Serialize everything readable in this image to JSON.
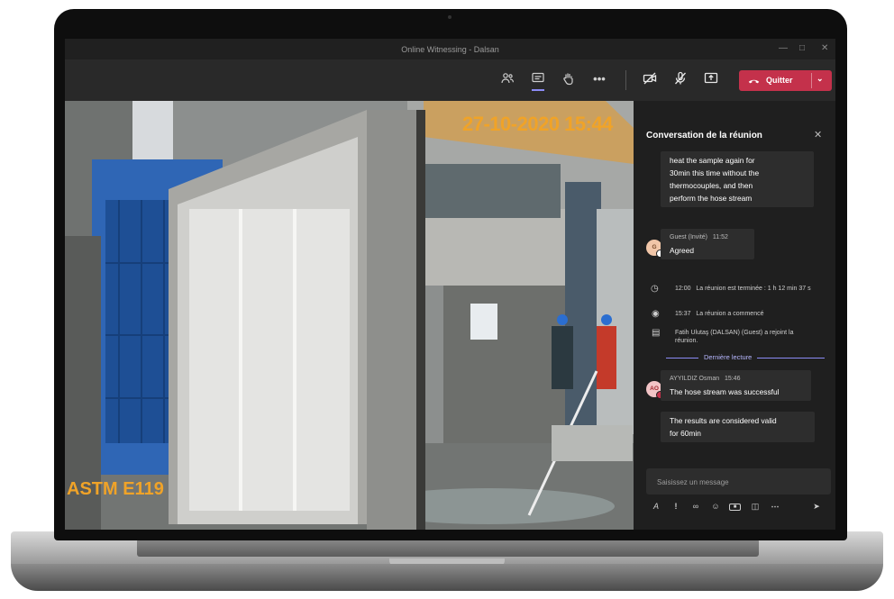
{
  "window": {
    "title": "Online Witnessing - Dalsan"
  },
  "toolbar": {
    "icons": [
      "participants-icon",
      "chat-icon",
      "raise-hand-icon",
      "more-icon",
      "camera-off-icon",
      "mic-off-icon",
      "share-screen-icon"
    ],
    "leave_label": "Quitter"
  },
  "video": {
    "timestamp": "27-10-2020 15:44",
    "overlay_label": "ASTM E119"
  },
  "chat": {
    "title": "Conversation de la réunion",
    "message1_lines": [
      "heat the sample again for",
      "30min this time without the",
      "thermocouples, and then",
      "perform the hose stream"
    ],
    "guest": {
      "avatar": "G",
      "name": "Guest (Invité)",
      "time": "11:52",
      "text": "Agreed"
    },
    "events": [
      {
        "icon": "meeting-ended-icon",
        "time": "12:00",
        "text": "La réunion est terminée : 1 h 12 min 37 s"
      },
      {
        "icon": "meeting-started-icon",
        "time": "15:37",
        "text": "La réunion a commencé"
      },
      {
        "icon": "participant-joined-icon",
        "time": "",
        "text": "Fatih Ulutaş (DALSAN) (Guest) a rejoint la réunion."
      }
    ],
    "last_read_label": "Dernière lecture",
    "osman": {
      "avatar": "AO",
      "name": "AYYILDIZ Osman",
      "time": "15:46",
      "text1": "The hose stream was successful",
      "text2_lines": [
        "The results are considered valid",
        "for 60min"
      ]
    },
    "compose_placeholder": "Saisissez un message",
    "format_icons": [
      "format-icon",
      "important-icon",
      "attach-icon",
      "emoji-icon",
      "gif-icon",
      "sticker-icon",
      "more-options-icon",
      "send-icon"
    ]
  },
  "colors": {
    "accent": "#8b8bf5",
    "leave": "#c4314b",
    "stamp": "#f0a328",
    "presence_busy": "#c4314b"
  }
}
